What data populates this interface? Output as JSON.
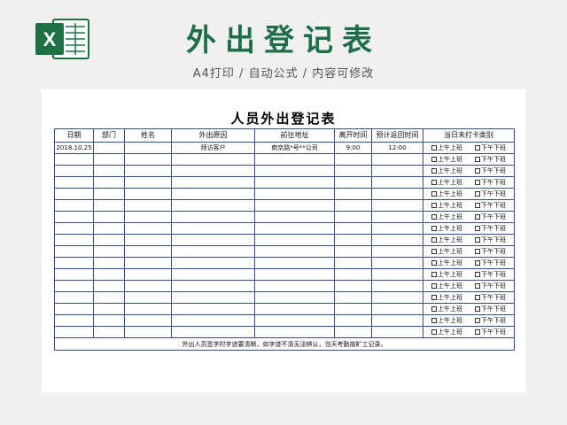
{
  "header": {
    "title": "外出登记表",
    "subtitle": "A4打印 / 自动公式 / 内容可修改",
    "logo_icon": "excel-logo-icon",
    "accent_color": "#1e6e4a"
  },
  "sheet": {
    "title": "人员外出登记表",
    "columns": [
      "日期",
      "部门",
      "姓名",
      "外出原因",
      "前往地址",
      "离开时间",
      "预计返回时间",
      "当日未打卡类别"
    ],
    "first_row": {
      "date": "2018.10.25",
      "department": "",
      "name": "",
      "reason": "拜访客户",
      "address": "南京路*号**公司",
      "leave_time": "9:00",
      "return_time": "12:00"
    },
    "checkbox_labels": {
      "am": "上午上班",
      "pm": "下午下班"
    },
    "row_count": 17,
    "note": "外出人员签字时字迹要清晰，如字迹不清无法辨认，当天考勤按旷工记录。"
  }
}
